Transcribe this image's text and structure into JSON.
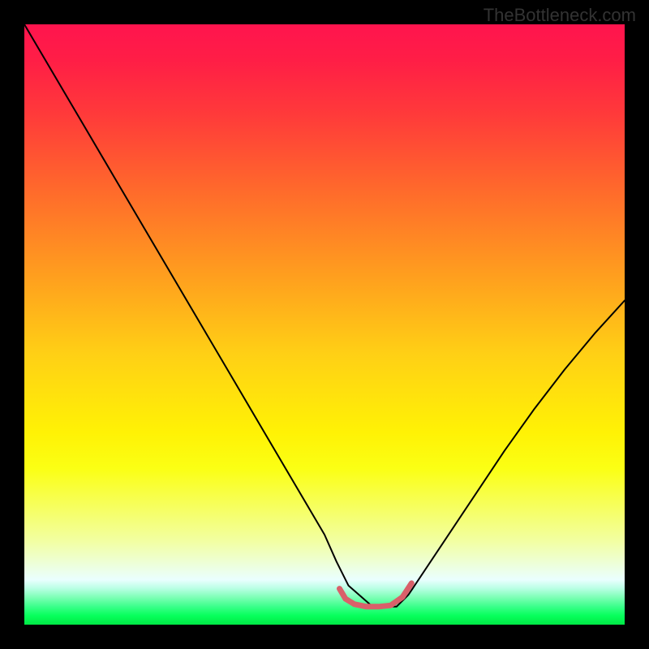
{
  "watermark": "TheBottleneck.com",
  "chart_data": {
    "type": "line",
    "title": "",
    "xlabel": "",
    "ylabel": "",
    "xlim": [
      0,
      100
    ],
    "ylim": [
      0,
      100
    ],
    "background_gradient": {
      "stops": [
        {
          "pos": 0,
          "color": "#ff144e"
        },
        {
          "pos": 15,
          "color": "#ff3a3a"
        },
        {
          "pos": 42,
          "color": "#ff9f1e"
        },
        {
          "pos": 68,
          "color": "#fff205"
        },
        {
          "pos": 92,
          "color": "#eaffff"
        },
        {
          "pos": 100,
          "color": "#00e845"
        }
      ]
    },
    "series": [
      {
        "name": "bottleneck-curve",
        "color": "#000000",
        "stroke_width": 2,
        "x": [
          0,
          5,
          10,
          15,
          20,
          25,
          30,
          35,
          40,
          45,
          50,
          52,
          54,
          58,
          62,
          64,
          66,
          70,
          75,
          80,
          85,
          90,
          95,
          100
        ],
        "y": [
          100,
          91.5,
          83.0,
          74.5,
          66.0,
          57.5,
          49.0,
          40.5,
          32.0,
          23.5,
          15.0,
          10.5,
          6.5,
          3.0,
          3.0,
          5.0,
          8.0,
          14.0,
          21.5,
          29.0,
          36.0,
          42.5,
          48.5,
          54.0
        ]
      },
      {
        "name": "optimal-zone-marker",
        "color": "#d9606a",
        "stroke_width": 7,
        "x": [
          52.5,
          53.5,
          55,
          57,
          59,
          61,
          63,
          64.5
        ],
        "y": [
          6.0,
          4.3,
          3.4,
          3.0,
          3.0,
          3.2,
          4.6,
          6.9
        ]
      }
    ]
  }
}
